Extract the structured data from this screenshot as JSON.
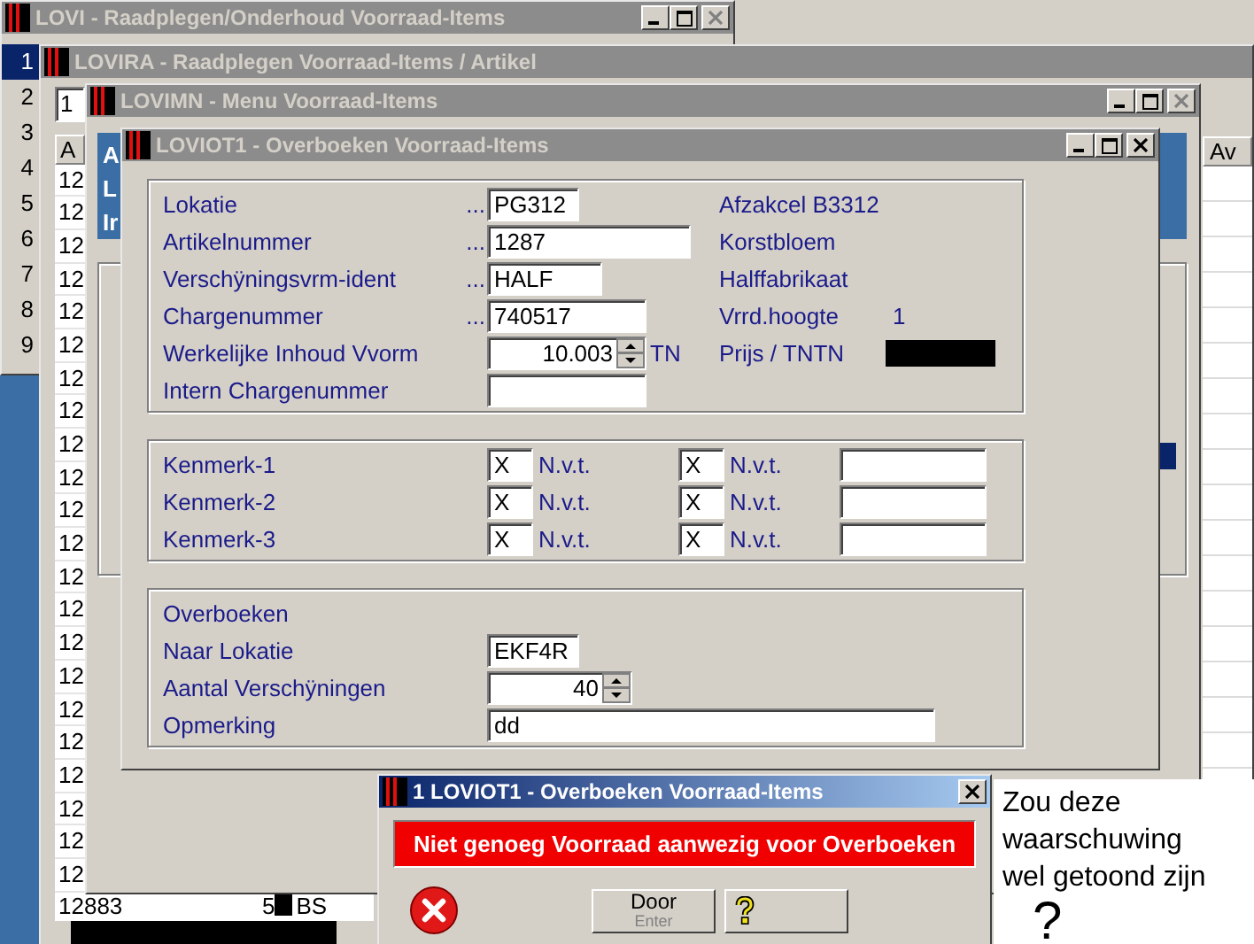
{
  "main_window": {
    "title": "LOVI - Raadplegen/Onderhoud Voorraad-Items",
    "active": false,
    "title_buttons": [
      {
        "kind": "minimize",
        "disabled": false
      },
      {
        "kind": "maximize",
        "disabled": false
      },
      {
        "kind": "close",
        "disabled": true
      }
    ],
    "row_numbers": [
      {
        "label": "1",
        "selected": true
      },
      {
        "label": "2",
        "selected": false
      },
      {
        "label": "3",
        "selected": false
      },
      {
        "label": "4",
        "selected": false
      },
      {
        "label": "5",
        "selected": false
      },
      {
        "label": "6",
        "selected": false
      },
      {
        "label": "7",
        "selected": false
      },
      {
        "label": "8",
        "selected": false
      },
      {
        "label": "9",
        "selected": false
      }
    ]
  },
  "article_window": {
    "title": "LOVIRA - Raadplegen Voorraad-Items / Artikel",
    "active": false,
    "search_value": "1",
    "table": {
      "columns": [
        "A",
        "Av"
      ],
      "column_1_cells": [
        "12",
        "12",
        "12",
        "12",
        "12",
        "12",
        "12",
        "12",
        "12",
        "12",
        "12",
        "12",
        "12",
        "12",
        "12",
        "12",
        "12",
        "12",
        "12",
        "12",
        "12",
        "12"
      ],
      "last_row": {
        "cells": [
          "12883",
          "5",
          "BS"
        ],
        "redacted": true
      }
    }
  },
  "menu_window": {
    "title": "LOVIMN - Menu Voorraad-Items",
    "active": false,
    "title_buttons": [
      {
        "kind": "minimize",
        "disabled": false
      },
      {
        "kind": "maximize",
        "disabled": false
      },
      {
        "kind": "close",
        "disabled": true
      }
    ],
    "panel_lines": [
      "A",
      "L",
      "Ir"
    ]
  },
  "transfer_window": {
    "title": "LOVIOT1 - Overboeken Voorraad-Items",
    "active": false,
    "title_buttons": [
      {
        "kind": "minimize",
        "disabled": false
      },
      {
        "kind": "maximize",
        "disabled": false
      },
      {
        "kind": "close",
        "disabled": false
      }
    ],
    "item_fields": [
      {
        "label": "Lokatie",
        "lookup": "...",
        "kind": "text",
        "value": "PG312",
        "info": "Afzakcel B3312"
      },
      {
        "label": "Artikelnummer",
        "lookup": "...",
        "kind": "text",
        "value": "1287",
        "info": "Korstbloem"
      },
      {
        "label": "Verschÿningsvrm-ident",
        "lookup": "...",
        "kind": "text",
        "value": "HALF",
        "info": "Halffabrikaat"
      },
      {
        "label": "Chargenummer",
        "lookup": "...",
        "kind": "text",
        "value": "740517",
        "info": "Vrrd.hoogte",
        "info_value": "1"
      },
      {
        "label": "Werkelijke Inhoud Vvorm",
        "kind": "spinner",
        "value": "10.003",
        "unit": "TN",
        "info": "Prijs / TNTN",
        "info_redacted": true
      },
      {
        "label": "Intern Chargenummer",
        "kind": "text"
      }
    ],
    "characteristics": [
      {
        "label": "Kenmerk-1",
        "code_1": "X",
        "text_1": "N.v.t.",
        "code_2": "X",
        "text_2": "N.v.t."
      },
      {
        "label": "Kenmerk-2",
        "code_1": "X",
        "text_1": "N.v.t.",
        "code_2": "X",
        "text_2": "N.v.t."
      },
      {
        "label": "Kenmerk-3",
        "code_1": "X",
        "text_1": "N.v.t.",
        "code_2": "X",
        "text_2": "N.v.t."
      }
    ],
    "transfer": {
      "heading": "Overboeken",
      "fields": [
        {
          "label": "Naar Lokatie",
          "kind": "text",
          "value": "EKF4R"
        },
        {
          "label": "Aantal Verschÿningen",
          "kind": "spinner",
          "value": "40"
        },
        {
          "label": "Opmerking",
          "kind": "text",
          "value": "dd"
        }
      ]
    }
  },
  "alert": {
    "title": "1 LOVIOT1 - Overboeken Voorraad-Items",
    "active": true,
    "title_buttons": [
      {
        "kind": "close",
        "disabled": false
      }
    ],
    "message": "Niet genoeg Voorraad aanwezig voor Overboeken",
    "buttons": [
      {
        "kind": "text",
        "label": "Door",
        "hint": "Enter"
      },
      {
        "kind": "help"
      }
    ]
  },
  "note": {
    "text": "Zou deze waarschuwing wel getoond zijn",
    "mark": "?"
  }
}
